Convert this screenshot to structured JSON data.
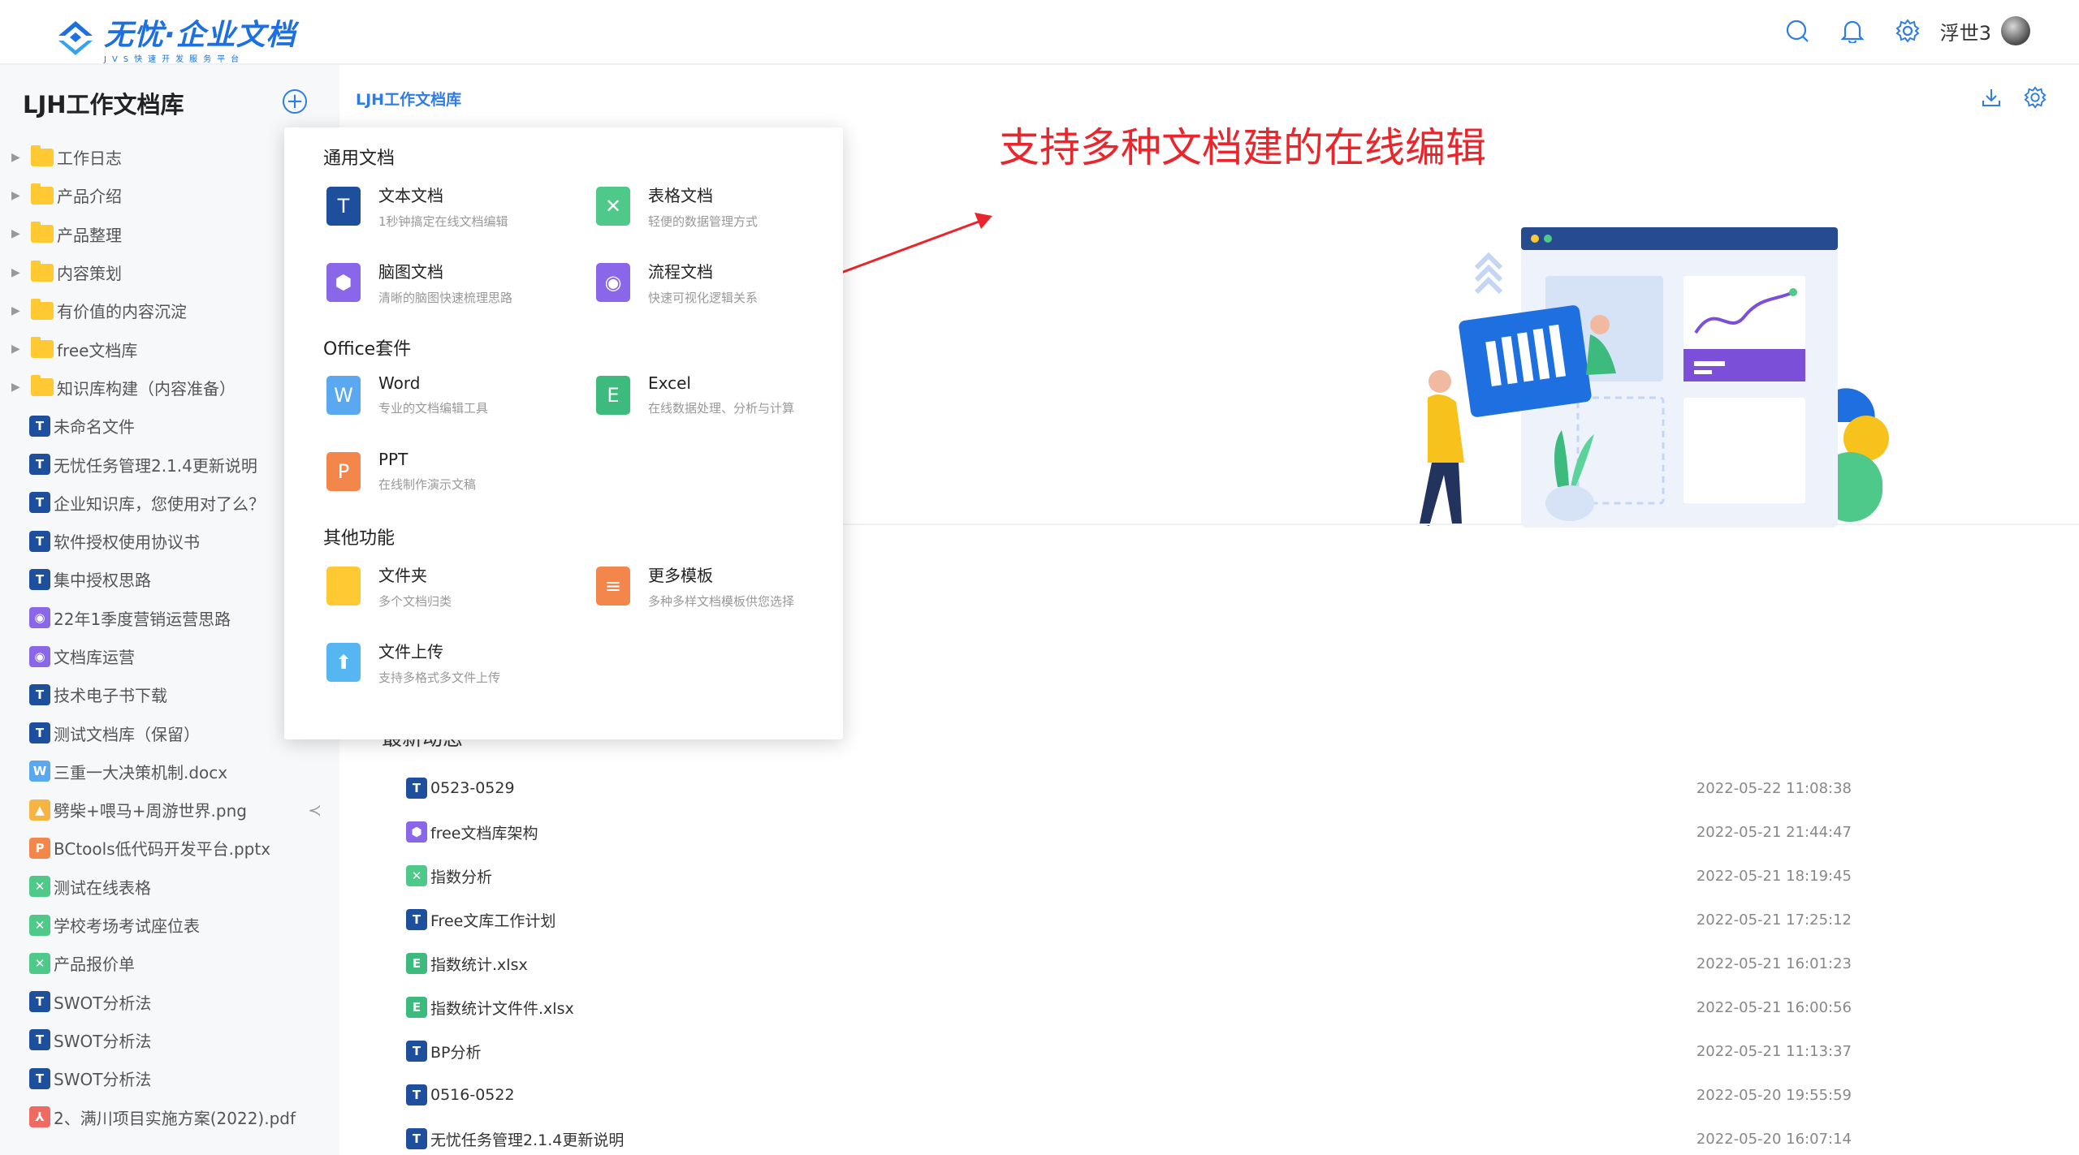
{
  "brand": {
    "name": "无忧·企业文档",
    "tagline": "JVS快速开发服务平台"
  },
  "header": {
    "username": "浮世3",
    "icons": [
      "search-icon",
      "bell-icon",
      "gear-icon"
    ]
  },
  "sidebar": {
    "library_title": "LJH工作文档库",
    "items": [
      {
        "label": "工作日志",
        "type": "folder"
      },
      {
        "label": "产品介绍",
        "type": "folder"
      },
      {
        "label": "产品整理",
        "type": "folder"
      },
      {
        "label": "内容策划",
        "type": "folder"
      },
      {
        "label": "有价值的内容沉淀",
        "type": "folder"
      },
      {
        "label": "free文档库",
        "type": "folder"
      },
      {
        "label": "知识库构建（内容准备）",
        "type": "folder"
      },
      {
        "label": "未命名文件",
        "type": "text",
        "glyph": "T",
        "color": "#1d4f9c"
      },
      {
        "label": "无忧任务管理2.1.4更新说明",
        "type": "text",
        "glyph": "T",
        "color": "#1d4f9c"
      },
      {
        "label": "企业知识库，您使用对了么？",
        "type": "text",
        "glyph": "T",
        "color": "#1d4f9c"
      },
      {
        "label": "软件授权使用协议书",
        "type": "text",
        "glyph": "T",
        "color": "#1d4f9c"
      },
      {
        "label": "集中授权思路",
        "type": "text",
        "glyph": "T",
        "color": "#1d4f9c"
      },
      {
        "label": "22年1季度营销运营思路",
        "type": "flow",
        "glyph": "◉",
        "color": "#8a66e8"
      },
      {
        "label": "文档库运营",
        "type": "flow",
        "glyph": "◉",
        "color": "#8a66e8"
      },
      {
        "label": "技术电子书下载",
        "type": "text",
        "glyph": "T",
        "color": "#1d4f9c"
      },
      {
        "label": "测试文档库（保留）",
        "type": "text",
        "glyph": "T",
        "color": "#1d4f9c"
      },
      {
        "label": "三重一大决策机制.docx",
        "type": "word",
        "glyph": "W",
        "color": "#5aa9f0"
      },
      {
        "label": "劈柴+喂马+周游世界.png",
        "type": "image",
        "glyph": "▲",
        "color": "#f6b443"
      },
      {
        "label": "BCtools低代码开发平台.pptx",
        "type": "ppt",
        "glyph": "P",
        "color": "#f3864a"
      },
      {
        "label": "测试在线表格",
        "type": "sheet",
        "glyph": "✕",
        "color": "#4fc98a"
      },
      {
        "label": "学校考场考试座位表",
        "type": "sheet",
        "glyph": "✕",
        "color": "#4fc98a"
      },
      {
        "label": "产品报价单",
        "type": "sheet",
        "glyph": "✕",
        "color": "#4fc98a"
      },
      {
        "label": "SWOT分析法",
        "type": "text",
        "glyph": "T",
        "color": "#1d4f9c"
      },
      {
        "label": "SWOT分析法",
        "type": "text",
        "glyph": "T",
        "color": "#1d4f9c"
      },
      {
        "label": "SWOT分析法",
        "type": "text",
        "glyph": "T",
        "color": "#1d4f9c"
      },
      {
        "label": "2、满川项目实施方案(2022).pdf",
        "type": "pdf",
        "glyph": "⅄",
        "color": "#ef6a62"
      }
    ]
  },
  "main": {
    "breadcrumb": "LJH工作文档库",
    "annotation": "支持多种文档建的在线编辑",
    "activity_title": "最新动态",
    "activity": [
      {
        "name": "0523-0529",
        "glyph": "T",
        "color": "#1d4f9c",
        "time": "2022-05-22 11:08:38"
      },
      {
        "name": "free文档库架构",
        "glyph": "⬢",
        "color": "#8a66e8",
        "time": "2022-05-21 21:44:47"
      },
      {
        "name": "指数分析",
        "glyph": "✕",
        "color": "#4fc98a",
        "time": "2022-05-21 18:19:45"
      },
      {
        "name": "Free文库工作计划",
        "glyph": "T",
        "color": "#1d4f9c",
        "time": "2022-05-21 17:25:12"
      },
      {
        "name": "指数统计.xlsx",
        "glyph": "E",
        "color": "#3dbb7f",
        "time": "2022-05-21 16:01:23"
      },
      {
        "name": "指数统计文件件.xlsx",
        "glyph": "E",
        "color": "#3dbb7f",
        "time": "2022-05-21 16:00:56"
      },
      {
        "name": "BP分析",
        "glyph": "T",
        "color": "#1d4f9c",
        "time": "2022-05-21 11:13:37"
      },
      {
        "name": "0516-0522",
        "glyph": "T",
        "color": "#1d4f9c",
        "time": "2022-05-20 19:55:59"
      },
      {
        "name": "无忧任务管理2.1.4更新说明",
        "glyph": "T",
        "color": "#1d4f9c",
        "time": "2022-05-20 16:07:14"
      }
    ]
  },
  "popup": {
    "sections": [
      {
        "title": "通用文档",
        "items": [
          {
            "name": "文本文档",
            "desc": "1秒钟搞定在线文档编辑",
            "glyph": "T",
            "color": "#1d4f9c",
            "icon": "text-doc-icon"
          },
          {
            "name": "表格文档",
            "desc": "轻便的数据管理方式",
            "glyph": "✕",
            "color": "#4fc98a",
            "icon": "sheet-doc-icon"
          },
          {
            "name": "脑图文档",
            "desc": "清晰的脑图快速梳理思路",
            "glyph": "⬢",
            "color": "#8a66e8",
            "icon": "mindmap-doc-icon"
          },
          {
            "name": "流程文档",
            "desc": "快速可视化逻辑关系",
            "glyph": "◉",
            "color": "#8a66e8",
            "icon": "flow-doc-icon"
          }
        ]
      },
      {
        "title": "Office套件",
        "items": [
          {
            "name": "Word",
            "desc": "专业的文档编辑工具",
            "glyph": "W",
            "color": "#5aa9f0",
            "icon": "word-icon"
          },
          {
            "name": "Excel",
            "desc": "在线数据处理、分析与计算",
            "glyph": "E",
            "color": "#3dbb7f",
            "icon": "excel-icon"
          },
          {
            "name": "PPT",
            "desc": "在线制作演示文稿",
            "glyph": "P",
            "color": "#f3864a",
            "icon": "ppt-icon"
          }
        ]
      },
      {
        "title": "其他功能",
        "items": [
          {
            "name": "文件夹",
            "desc": "多个文档归类",
            "glyph": "",
            "color": "#ffc933",
            "icon": "folder-icon"
          },
          {
            "name": "更多模板",
            "desc": "多种多样文档模板供您选择",
            "glyph": "≡",
            "color": "#f3864a",
            "icon": "template-icon"
          },
          {
            "name": "文件上传",
            "desc": "支持多格式多文件上传",
            "glyph": "⬆",
            "color": "#56b6f2",
            "icon": "upload-icon"
          }
        ]
      }
    ]
  }
}
